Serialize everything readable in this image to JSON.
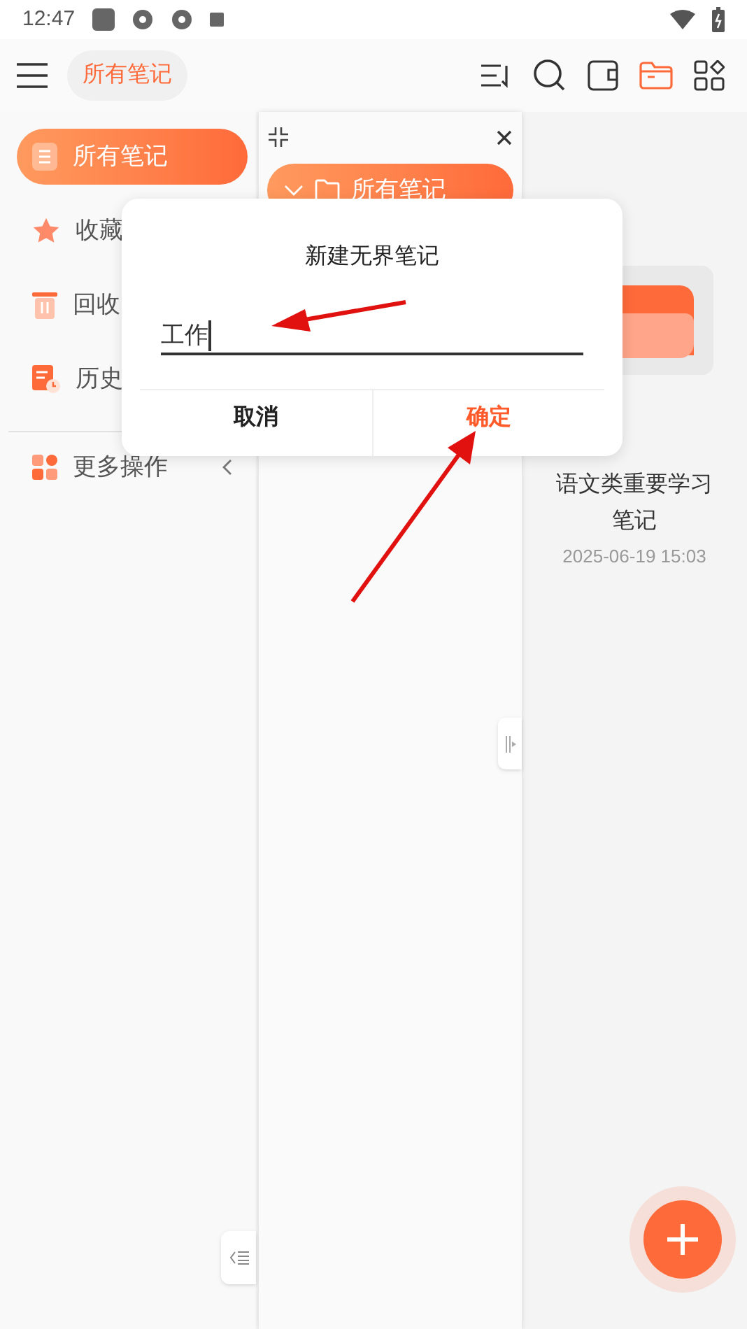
{
  "status_bar": {
    "time": "12:47"
  },
  "top_bar": {
    "title": "所有笔记"
  },
  "sidebar": {
    "items": [
      {
        "label": "所有笔记",
        "kind": "notes",
        "selected": true
      },
      {
        "label": "收藏",
        "kind": "favorites",
        "selected": false
      },
      {
        "label": "回收",
        "kind": "trash",
        "selected": false
      },
      {
        "label": "历史",
        "kind": "history",
        "selected": false
      },
      {
        "label": "更多操作",
        "kind": "more",
        "selected": false
      }
    ]
  },
  "folder_panel": {
    "folder": {
      "label": "所有笔记",
      "expanded": true
    }
  },
  "notes": [
    {
      "title": "语文类重要学习笔记",
      "date": "2025-06-19 15:03"
    }
  ],
  "dialog": {
    "title": "新建无界笔记",
    "input": {
      "value": "工作"
    },
    "buttons": [
      {
        "label": "取消",
        "kind": "cancel"
      },
      {
        "label": "确定",
        "kind": "confirm"
      }
    ]
  }
}
